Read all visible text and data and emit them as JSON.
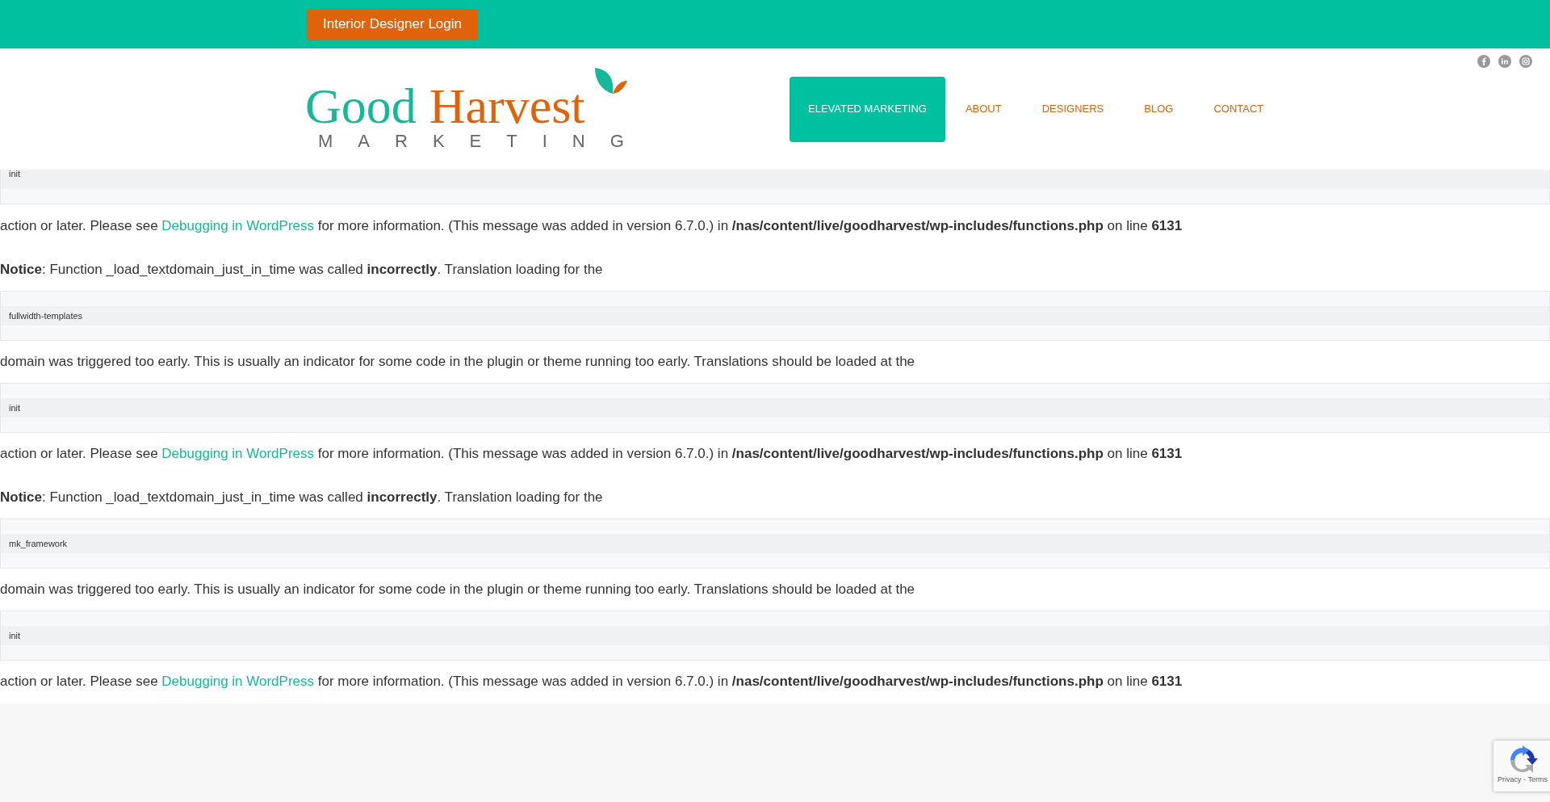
{
  "top_bar": {
    "login_button": "Interior Designer Login"
  },
  "header": {
    "logo": {
      "word_1": "Good",
      "word_2": "Harvest",
      "tagline": "MARKETING"
    },
    "nav": [
      {
        "label": "ELEVATED MARKETING",
        "selected": true
      },
      {
        "label": "ABOUT",
        "selected": false
      },
      {
        "label": "DESIGNERS",
        "selected": false
      },
      {
        "label": "BLOG",
        "selected": false
      },
      {
        "label": "CONTACT",
        "selected": false
      }
    ]
  },
  "messages": [
    {
      "kind": "code",
      "text": "init",
      "cut": true
    },
    {
      "kind": "link_text",
      "before": "action or later. Please see ",
      "link": "Debugging in WordPress",
      "after": " for more information. (This message was added in version 6.7.0.) in **/nas/content/live/goodharvest/wp-includes/functions.php** on line **6131**"
    },
    {
      "kind": "text",
      "text": "**Notice**: Function _load_textdomain_just_in_time was called **incorrectly**. Translation loading for the"
    },
    {
      "kind": "code",
      "text": "fullwidth-templates",
      "cut": false
    },
    {
      "kind": "text",
      "text": "domain was triggered too early. This is usually an indicator for some code in the plugin or theme running too early. Translations should be loaded at the"
    },
    {
      "kind": "code",
      "text": "init",
      "cut": false
    },
    {
      "kind": "link_text",
      "before": "action or later. Please see ",
      "link": "Debugging in WordPress",
      "after": " for more information. (This message was added in version 6.7.0.) in **/nas/content/live/goodharvest/wp-includes/functions.php** on line **6131**"
    },
    {
      "kind": "text",
      "text": "**Notice**: Function _load_textdomain_just_in_time was called **incorrectly**. Translation loading for the"
    },
    {
      "kind": "code",
      "text": "mk_framework",
      "cut": false
    },
    {
      "kind": "text",
      "text": "domain was triggered too early. This is usually an indicator for some code in the plugin or theme running too early. Translations should be loaded at the"
    },
    {
      "kind": "code",
      "text": "init",
      "cut": false
    },
    {
      "kind": "link_text",
      "before": "action or later. Please see ",
      "link": "Debugging in WordPress",
      "after": " for more information. (This message was added in version 6.7.0.) in **/nas/content/live/goodharvest/wp-includes/functions.php** on line **6131**"
    }
  ],
  "recaptcha": {
    "links": "Privacy - Terms"
  }
}
